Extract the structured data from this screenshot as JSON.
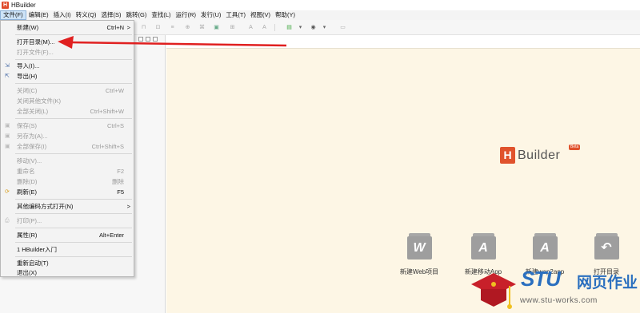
{
  "app": {
    "logo_letter": "H",
    "title": "HBuilder"
  },
  "menubar": [
    "文件(F)",
    "编辑(E)",
    "插入(I)",
    "转义(Q)",
    "选择(S)",
    "跳转(G)",
    "查找(L)",
    "运行(R)",
    "发行(U)",
    "工具(T)",
    "视图(V)",
    "帮助(Y)"
  ],
  "file_menu": [
    {
      "label": "新建(W)",
      "shortcut": "Ctrl+N",
      "arrow": ">",
      "enabled": true,
      "icon": ""
    },
    {
      "label": "打开目录(M)...",
      "shortcut": "",
      "enabled": true,
      "icon": ""
    },
    {
      "label": "打开文件(F)...",
      "shortcut": "",
      "enabled": false,
      "icon": ""
    },
    {
      "label": "导入(I)...",
      "shortcut": "",
      "enabled": true,
      "icon": "import-icon"
    },
    {
      "label": "导出(H)",
      "shortcut": "",
      "enabled": true,
      "icon": "export-icon"
    },
    {
      "label": "关闭(C)",
      "shortcut": "Ctrl+W",
      "enabled": false,
      "icon": ""
    },
    {
      "label": "关闭其他文件(K)",
      "shortcut": "",
      "enabled": false,
      "icon": ""
    },
    {
      "label": "全部关闭(L)",
      "shortcut": "Ctrl+Shift+W",
      "enabled": false,
      "icon": ""
    },
    {
      "label": "保存(S)",
      "shortcut": "Ctrl+S",
      "enabled": false,
      "icon": "save-icon"
    },
    {
      "label": "另存为(A)...",
      "shortcut": "",
      "enabled": false,
      "icon": "save-as-icon"
    },
    {
      "label": "全部保存(I)",
      "shortcut": "Ctrl+Shift+S",
      "enabled": false,
      "icon": "save-all-icon"
    },
    {
      "label": "移动(V)...",
      "shortcut": "",
      "enabled": false,
      "icon": ""
    },
    {
      "label": "重命名",
      "shortcut": "F2",
      "enabled": false,
      "icon": ""
    },
    {
      "label": "删除(D)",
      "shortcut": "删除",
      "enabled": false,
      "icon": ""
    },
    {
      "label": "刷新(E)",
      "shortcut": "F5",
      "enabled": true,
      "icon": "refresh-icon"
    },
    {
      "label": "其他编码方式打开(N)",
      "shortcut": "",
      "arrow": ">",
      "enabled": true,
      "icon": ""
    },
    {
      "label": "打印(P)...",
      "shortcut": "",
      "enabled": false,
      "icon": "print-icon"
    },
    {
      "label": "属性(R)",
      "shortcut": "Alt+Enter",
      "enabled": true,
      "icon": ""
    },
    {
      "label": "1 HBuilder入门",
      "shortcut": "",
      "enabled": true,
      "icon": ""
    },
    {
      "label": "重新启动(T)",
      "shortcut": "",
      "enabled": true,
      "icon": ""
    },
    {
      "label": "退出(X)",
      "shortcut": "",
      "enabled": true,
      "icon": ""
    }
  ],
  "brand": {
    "mark": "H",
    "name": "Builder",
    "beta": "Beta"
  },
  "quick_actions": [
    {
      "glyph": "W",
      "label": "新建Web项目"
    },
    {
      "glyph": "A",
      "label": "新建移动App"
    },
    {
      "glyph": "A",
      "label": "新建wap2app"
    },
    {
      "glyph": "↶",
      "label": "打开目录"
    }
  ],
  "watermark": {
    "stu": "STU",
    "cn": "网页作业",
    "url": "www.stu-works.com"
  },
  "colors": {
    "accent": "#e0522c",
    "editor_bg": "#fdf6e5",
    "watermark": "#2a6fbf",
    "arrow": "#e02020"
  }
}
